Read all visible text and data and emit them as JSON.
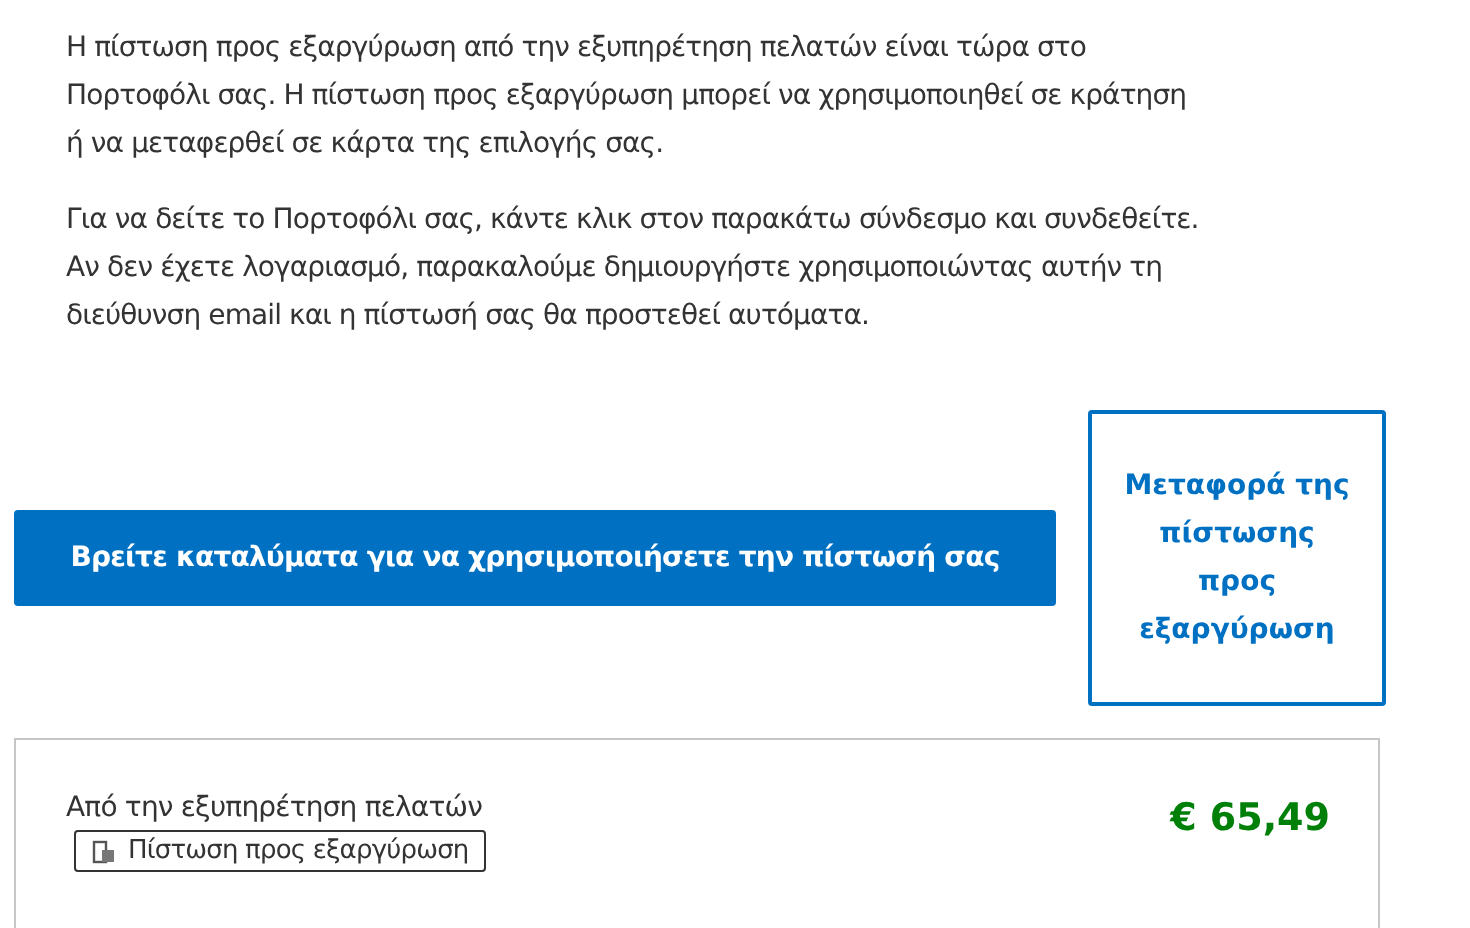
{
  "paragraphs": [
    [
      "Η πίστωση προς εξαργύρωση από την εξυπηρέτηση πελατών είναι τώρα στο",
      "Πορτοφόλι σας. Η πίστωση προς εξαργύρωση μπορεί να χρησιμοποιηθεί σε κράτηση",
      "ή να μεταφερθεί σε κάρτα της επιλογής σας."
    ],
    [
      "Για να δείτε το Πορτοφόλι σας, κάντε κλικ στον παρακάτω σύνδεσμο και συνδεθείτε.",
      "Αν δεν έχετε λογαριασμό, παρακαλούμε δημιουργήστε χρησιμοποιώντας αυτήν τη",
      "διεύθυνση email και η πίστωσή σας θα προστεθεί αυτόματα."
    ]
  ],
  "primary_button": "Βρείτε καταλύματα για να χρησιμοποιήσετε την πίστωσή σας",
  "secondary_button": "Μεταφορά της πίστωσης προς εξαργύρωση",
  "credit_card": {
    "source": "Από την εξυπηρέτηση πελατών",
    "badge": "Πίστωση προς εξαργύρωση",
    "amount": "€ 65,49"
  }
}
